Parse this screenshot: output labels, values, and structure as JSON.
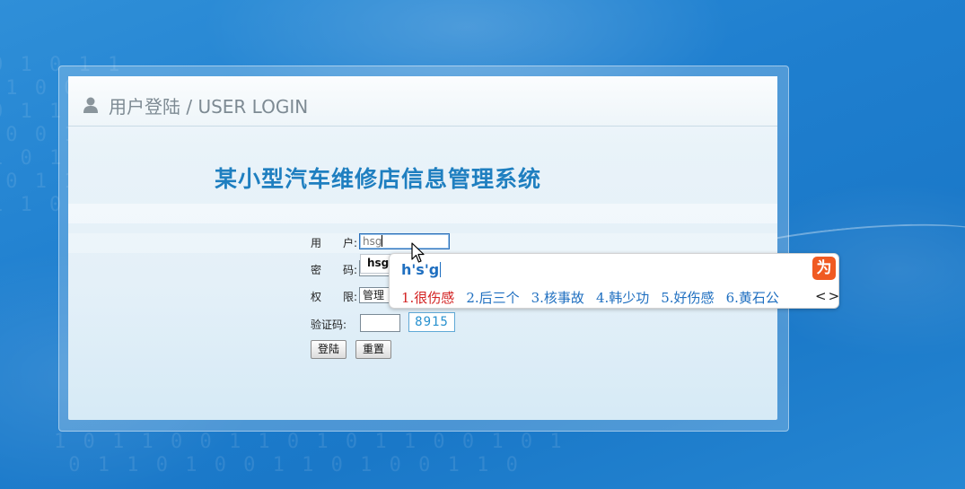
{
  "panel": {
    "title": "用户登陆 / USER LOGIN",
    "system_title": "某小型汽车维修店信息管理系统"
  },
  "form": {
    "username_label": "用　　户:",
    "username_value": "hsg",
    "password_label": "密　　码:",
    "role_label": "权　　限:",
    "role_value": "管理",
    "captcha_label": "验证码:",
    "captcha_code": "8915",
    "login_button": "登陆",
    "reset_button": "重置"
  },
  "autocomplete": {
    "suggestion": "hsg"
  },
  "ime": {
    "composition": "h's'g",
    "candidates": [
      "1.很伤感",
      "2.后三个",
      "3.核事故",
      "4.韩少功",
      "5.好伤感",
      "6.黄石公"
    ],
    "nav": "<>"
  },
  "colors": {
    "background": "#1f7fcf",
    "title_blue": "#1f7fc0",
    "candidate_selected": "#d32222",
    "ime_logo": "#f05a22"
  },
  "icons": [
    "user-icon",
    "ime-logo-icon",
    "mouse-cursor-icon"
  ]
}
